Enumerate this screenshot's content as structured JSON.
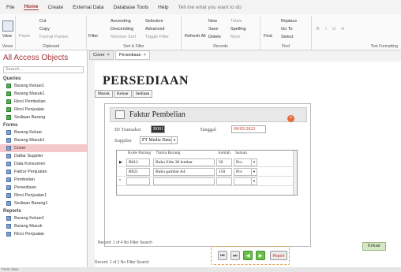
{
  "ribbon": {
    "tabs": [
      "File",
      "Home",
      "Create",
      "External Data",
      "Database Tools",
      "Help"
    ],
    "tellme": "Tell me what you want to do",
    "groups": {
      "views": "Views",
      "clipboard": "Clipboard",
      "sortfilter": "Sort & Filter",
      "records": "Records",
      "find": "Find",
      "textformatting": "Text Formatting"
    },
    "buttons": {
      "view": "View",
      "paste": "Paste",
      "cut": "Cut",
      "copy": "Copy",
      "format_painter": "Format Painter",
      "filter": "Filter",
      "ascending": "Ascending",
      "descending": "Descending",
      "remove_sort": "Remove Sort",
      "selection": "Selection",
      "advanced": "Advanced",
      "toggle_filter": "Toggle Filter",
      "refresh": "Refresh All",
      "new": "New",
      "save": "Save",
      "delete": "Delete",
      "totals": "Totals",
      "spelling": "Spelling",
      "more": "More",
      "find": "Find",
      "replace": "Replace",
      "goto": "Go To",
      "select": "Select"
    }
  },
  "nav": {
    "title": "All Access Objects",
    "search_placeholder": "Search...",
    "sections": [
      {
        "name": "Queries",
        "items": [
          "Barang Keluar1",
          "Barang Masuk1",
          "Rinci Pembelian",
          "Rinci Penjualan",
          "Sediaan Barang"
        ]
      },
      {
        "name": "Forms",
        "items": [
          "Barang Keluar",
          "Barang Masuk1",
          "Cover",
          "Daftar Supplier",
          "Data Konsumen",
          "Faktur Penjualan",
          "Pembelian",
          "Persediaan",
          "Rinci Penjualan1",
          "Sediaan Barang1"
        ]
      },
      {
        "name": "Reports",
        "items": [
          "Barang Keluar1",
          "Barang Masuk",
          "Rinci Penjualan"
        ]
      }
    ],
    "selected": "Cover"
  },
  "doc_tabs": [
    "Cover",
    "Persediaan"
  ],
  "form": {
    "title": "PERSEDIAAN",
    "nav_buttons": [
      "Masuk",
      "Keluar",
      "Sediaan"
    ],
    "sub_title": "Faktur Pembelian",
    "labels": {
      "id": "ID Transaksi",
      "tanggal": "Tanggal",
      "supplier": "Supplier"
    },
    "values": {
      "id": "B001",
      "tanggal": "09/05/2023",
      "supplier": "PT Media Data"
    },
    "grid_headers": [
      "Kode Barang",
      "Nama Barang",
      "Jumlah",
      "Satuan"
    ],
    "grid_rows": [
      {
        "kode": "B012",
        "nama": "Buku Sidu 38 lembar",
        "jumlah": "50",
        "satuan": "Pcs"
      },
      {
        "kode": "B021",
        "nama": "Buku gambar A4",
        "jumlah": "150",
        "satuan": "Pcs"
      }
    ],
    "inner_record": "Record: 1 of 4",
    "no_filter": "No Filter",
    "search": "Search",
    "report_btn": "Report",
    "keluar_btn": "Keluar"
  },
  "outer_record": "Record: 1 of 1",
  "status": "Form View"
}
